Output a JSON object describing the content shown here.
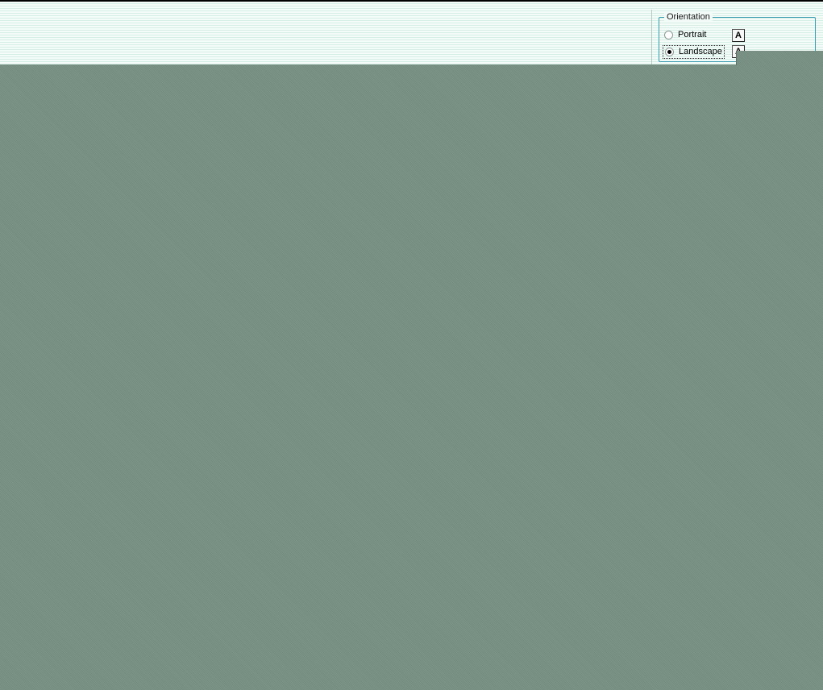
{
  "orientation_group": {
    "legend": "Orientation",
    "options": [
      {
        "label": "Portrait",
        "selected": false,
        "icon": "letter-a-portrait-icon",
        "icon_glyph": "A"
      },
      {
        "label": "Landscape",
        "selected": true,
        "icon": "letter-a-landscape-icon",
        "icon_glyph": "A"
      }
    ]
  },
  "colors": {
    "dialog_background": "#f0fbf7",
    "group_border": "#3a9bb0",
    "desktop_background": "#7c9488"
  }
}
